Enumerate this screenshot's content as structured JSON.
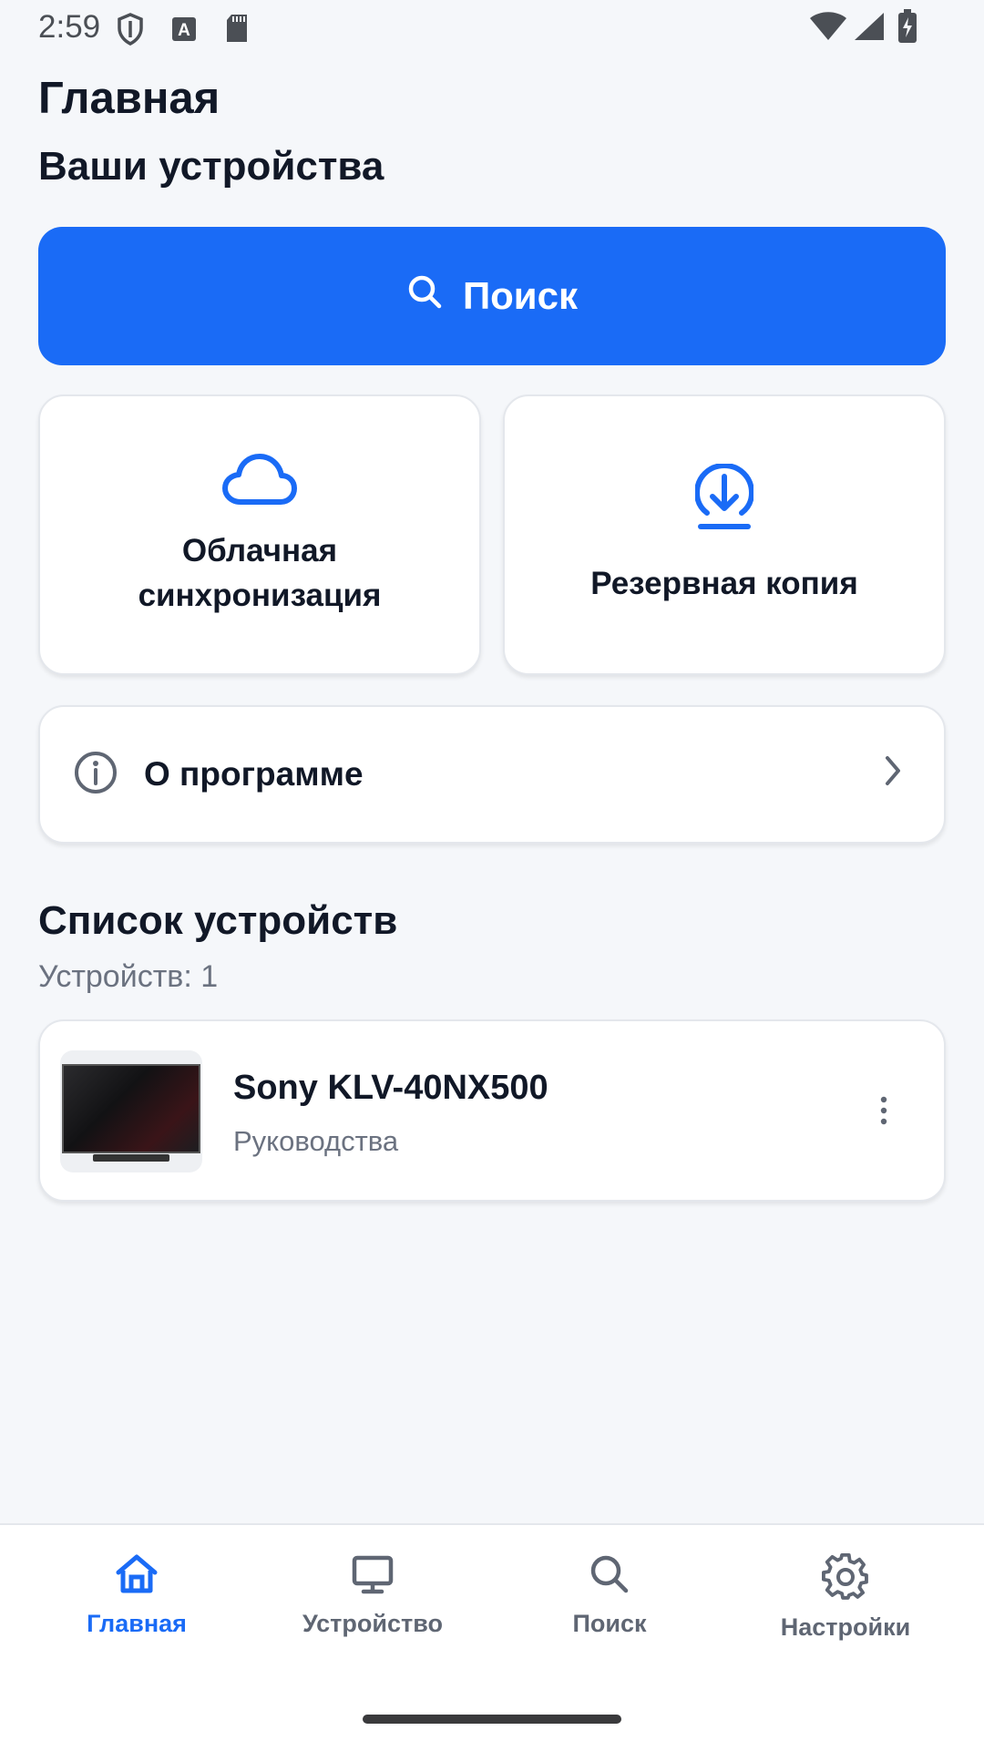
{
  "status_bar": {
    "time": "2:59",
    "icons": [
      "shield-icon",
      "a-icon",
      "sd-card-icon",
      "wifi-icon",
      "signal-icon",
      "battery-icon"
    ]
  },
  "header": {
    "title": "Главная",
    "subtitle": "Ваши устройства"
  },
  "search_button": {
    "label": "Поиск",
    "icon": "search-icon",
    "color": "#1a6bf6"
  },
  "tiles": [
    {
      "label": "Облачная синхронизация",
      "icon": "cloud-icon"
    },
    {
      "label": "Резервная копия",
      "icon": "download-icon"
    }
  ],
  "about": {
    "label": "О программе",
    "icon": "info-icon"
  },
  "device_list": {
    "title": "Список устройств",
    "count_text": "Устройств: 1",
    "items": [
      {
        "name": "Sony KLV-40NX500",
        "subtitle": "Руководства"
      }
    ]
  },
  "bottom_nav": {
    "items": [
      {
        "label": "Главная",
        "icon": "home-icon",
        "active": true
      },
      {
        "label": "Устройство",
        "icon": "monitor-icon",
        "active": false
      },
      {
        "label": "Поиск",
        "icon": "search-icon",
        "active": false
      },
      {
        "label": "Настройки",
        "icon": "gear-icon",
        "active": false
      }
    ],
    "active_color": "#1a6bf6",
    "inactive_color": "#5f6673"
  }
}
